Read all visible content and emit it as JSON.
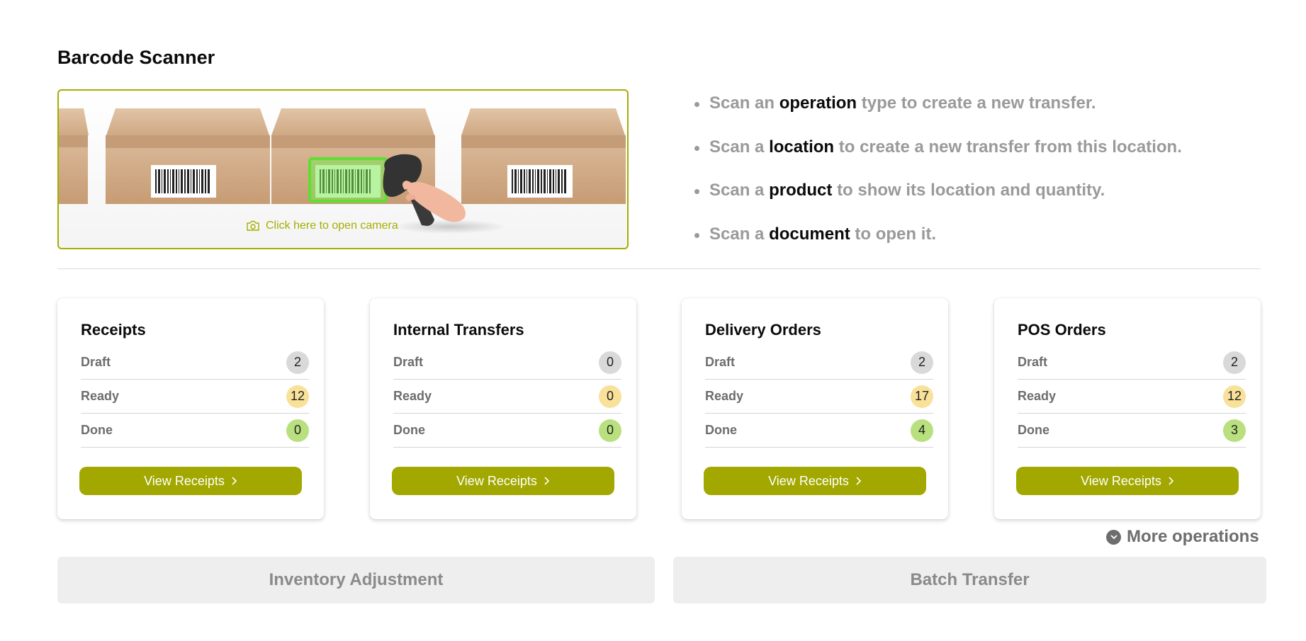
{
  "page": {
    "title": "Barcode Scanner"
  },
  "scanner": {
    "camera_hint": "Click here to open camera",
    "camera_icon": "camera-icon",
    "accent": "#a6ad00"
  },
  "instructions": [
    {
      "pre": "Scan an",
      "keyword": "operation",
      "post": "type to create a new transfer."
    },
    {
      "pre": "Scan a",
      "keyword": "location",
      "post": "to create a new transfer from this location."
    },
    {
      "pre": "Scan a",
      "keyword": "product",
      "post": "to show its location and quantity."
    },
    {
      "pre": "Scan a",
      "keyword": "document",
      "post": "to open it."
    }
  ],
  "operations": [
    {
      "title": "Receipts",
      "rows": [
        {
          "label": "Draft",
          "count": "2"
        },
        {
          "label": "Ready",
          "count": "12"
        },
        {
          "label": "Done",
          "count": "0"
        }
      ],
      "button": "View Receipts"
    },
    {
      "title": "Internal Transfers",
      "rows": [
        {
          "label": "Draft",
          "count": "0"
        },
        {
          "label": "Ready",
          "count": "0"
        },
        {
          "label": "Done",
          "count": "0"
        }
      ],
      "button": "View Receipts"
    },
    {
      "title": "Delivery Orders",
      "rows": [
        {
          "label": "Draft",
          "count": "2"
        },
        {
          "label": "Ready",
          "count": "17"
        },
        {
          "label": "Done",
          "count": "4"
        }
      ],
      "button": "View Receipts"
    },
    {
      "title": "POS Orders",
      "rows": [
        {
          "label": "Draft",
          "count": "2"
        },
        {
          "label": "Ready",
          "count": "12"
        },
        {
          "label": "Done",
          "count": "3"
        }
      ],
      "button": "View Receipts"
    }
  ],
  "more_operations": "More operations",
  "actions": {
    "inventory_adjustment": "Inventory Adjustment",
    "batch_transfer": "Batch Transfer"
  },
  "colors": {
    "button": "#a2a800",
    "draft": "#d9d9d9",
    "ready": "#f9e19a",
    "done": "#b8e07e"
  }
}
